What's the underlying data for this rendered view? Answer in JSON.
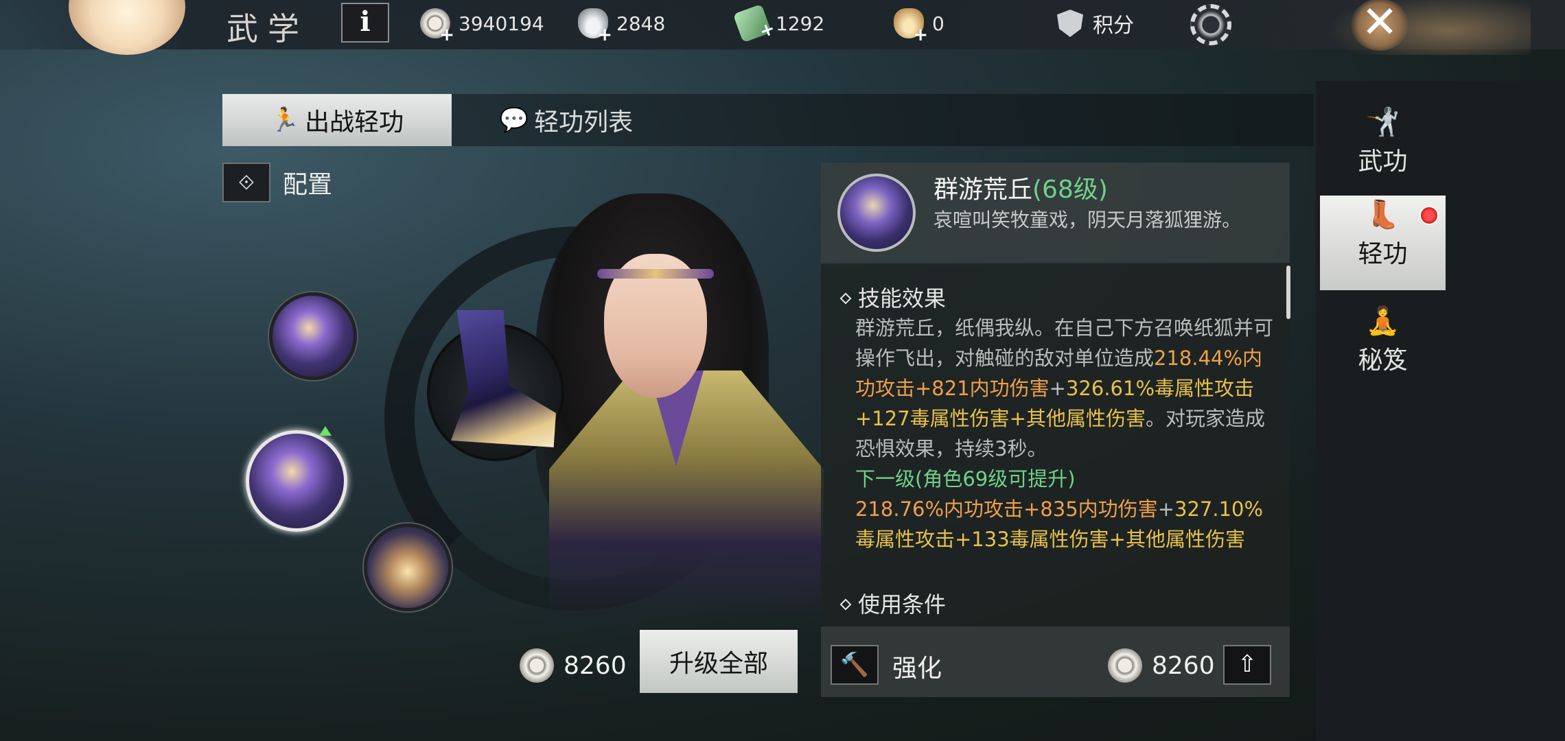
{
  "header": {
    "title": "武学",
    "info_label": "i",
    "currencies": [
      {
        "icon": "coin-icon",
        "value": "3940194"
      },
      {
        "icon": "silver-ingot-icon",
        "value": "2848"
      },
      {
        "icon": "jade-icon",
        "value": "1292"
      },
      {
        "icon": "gold-ingot-icon",
        "value": "0"
      }
    ],
    "score_label": "积分",
    "close_label": "✕"
  },
  "tabs": [
    {
      "label": "出战轻功",
      "active": true
    },
    {
      "label": "轻功列表",
      "active": false
    }
  ],
  "config_label": "配置",
  "rail": [
    {
      "label": "武功",
      "active": false
    },
    {
      "label": "轻功",
      "active": true,
      "badge": true
    },
    {
      "label": "秘笈",
      "active": false
    }
  ],
  "upgrade_all": {
    "cost": "8260",
    "label": "升级全部"
  },
  "skill": {
    "name": "群游荒丘",
    "level": "(68级)",
    "description": "哀喧叫笑牧童戏，阴天月落狐狸游。",
    "effect_title": "技能效果",
    "effect_intro": "群游荒丘，纸偶我纵。在自己下方召唤纸狐并可操作飞出，对触碰的敌对单位造成",
    "effect_current": {
      "a": "218.44%内功攻击+821内功伤害",
      "plus1": "+",
      "b": "326.61%毒属性攻击+127毒属性伤害+其他属性伤害",
      "tail": "。对玩家造成恐惧效果，持续3秒。"
    },
    "next_level_label": "下一级(角色69级可提升)",
    "effect_next": {
      "a": "218.76%内功攻击+835内功伤害",
      "plus1": "+",
      "b": "327.10%毒属性攻击+133毒属性伤害+其他属性伤害"
    },
    "condition_title": "使用条件",
    "enhance_label": "强化",
    "upgrade_cost": "8260"
  },
  "colors": {
    "accent_green": "#71d08a",
    "accent_orange": "#f0a04a",
    "accent_yellow": "#e8c14b",
    "badge_red": "#e02020"
  }
}
